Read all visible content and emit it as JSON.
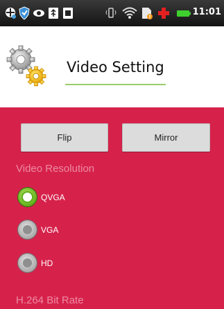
{
  "status_bar": {
    "time": "11:01",
    "icons": [
      "crosshair-icon",
      "shield-icon",
      "eye-icon",
      "usb-icon",
      "dark-box-icon",
      "vibrate-icon",
      "wifi-icon",
      "alert-sim-icon",
      "plus-icon",
      "battery-icon"
    ]
  },
  "header": {
    "title": "Video Setting",
    "icon": "gears-icon"
  },
  "buttons": {
    "flip_label": "Flip",
    "mirror_label": "Mirror"
  },
  "video_resolution": {
    "label": "Video Resolution",
    "options": [
      {
        "label": "QVGA",
        "checked": true
      },
      {
        "label": "VGA",
        "checked": false
      },
      {
        "label": "HD",
        "checked": false
      }
    ]
  },
  "bitrate": {
    "label": "H.264 Bit Rate"
  },
  "colors": {
    "panel": "#d6224b",
    "section_label": "#ee8aa2",
    "radio_checked": "#5fae1a",
    "underline": "#9acd6a"
  }
}
